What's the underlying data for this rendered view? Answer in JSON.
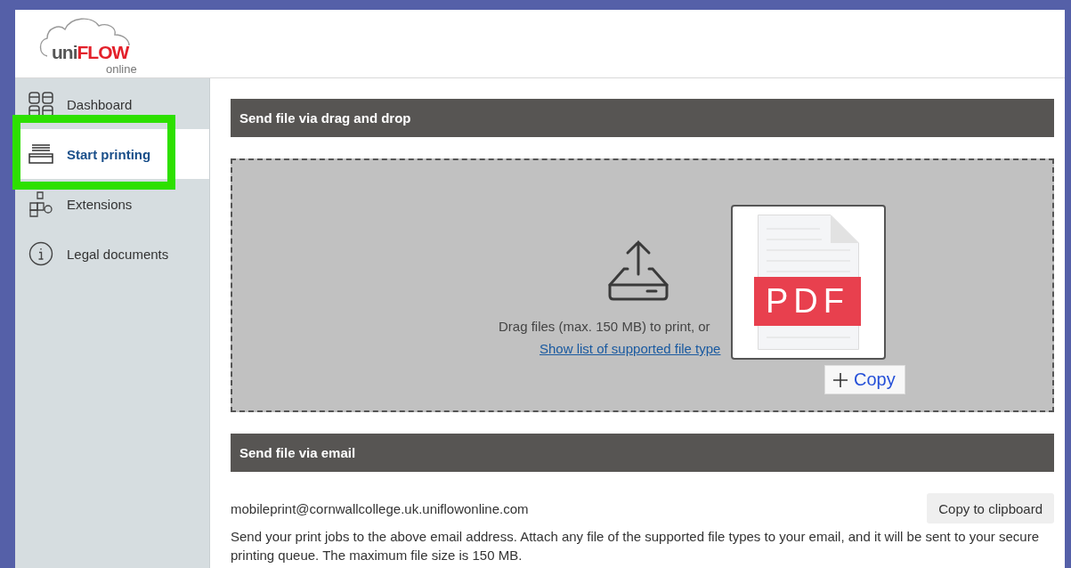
{
  "logo": {
    "prefix": "uni",
    "brand": "FLOW",
    "suffix": "online"
  },
  "sidebar": {
    "items": [
      {
        "label": "Dashboard",
        "selected": false,
        "highlighted": false
      },
      {
        "label": "Start printing",
        "selected": true,
        "highlighted": true
      },
      {
        "label": "Extensions",
        "selected": false,
        "highlighted": false
      },
      {
        "label": "Legal documents",
        "selected": false,
        "highlighted": false
      }
    ]
  },
  "drag_section": {
    "title": "Send file via drag and drop",
    "instruction": "Drag files (max. 150 MB) to print, or",
    "link": "Show list of supported file type",
    "drag_preview": {
      "badge": "PDF",
      "action": "Copy"
    }
  },
  "email_section": {
    "title": "Send file via email",
    "address": "mobileprint@cornwallcollege.uk.uniflowonline.com",
    "button": "Copy to clipboard",
    "description": "Send your print jobs to the above email address. Attach any file of the supported file types to your email, and it will be sent to your secure printing queue. The maximum file size is 150 MB."
  }
}
